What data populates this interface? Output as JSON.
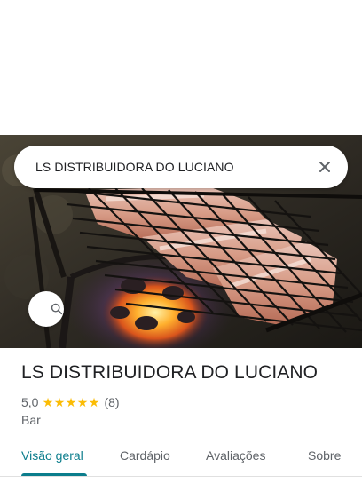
{
  "search": {
    "query": "LS DISTRIBUIDORA DO LUCIANO",
    "search_icon": "search-icon",
    "close_icon": "close-icon"
  },
  "place": {
    "name": "LS DISTRIBUIDORA DO LUCIANO",
    "rating": "5,0",
    "stars": 5,
    "review_count": "(8)",
    "category": "Bar"
  },
  "tabs": [
    {
      "label": "Visão geral",
      "active": true
    },
    {
      "label": "Cardápio",
      "active": false
    },
    {
      "label": "Avaliações",
      "active": false
    },
    {
      "label": "Sobre",
      "active": false
    }
  ],
  "colors": {
    "accent": "#0b7d8c",
    "star": "#fbbc04",
    "text_primary": "#202124",
    "text_secondary": "#5f6368"
  }
}
